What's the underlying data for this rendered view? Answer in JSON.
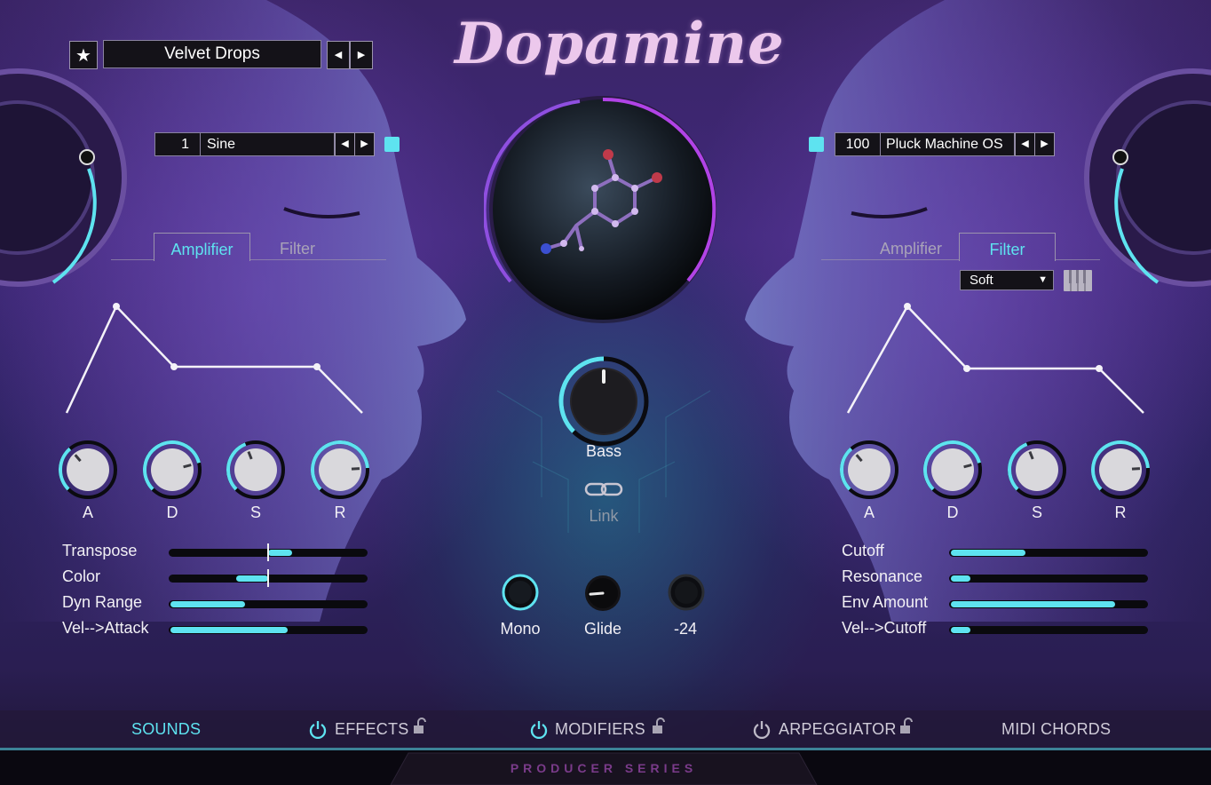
{
  "app": {
    "logo_text": "Dopamine",
    "footer_text": "PRODUCER SERIES"
  },
  "preset": {
    "name": "Velvet Drops",
    "favorite_icon": "star-icon",
    "prev_icon": "triangle-left-icon",
    "next_icon": "triangle-right-icon"
  },
  "left": {
    "osc_number": "1",
    "osc_name": "Sine",
    "tabs": [
      {
        "label": "Amplifier",
        "active": true
      },
      {
        "label": "Filter",
        "active": false
      }
    ],
    "knobs": [
      {
        "label": "A",
        "value": 0.35
      },
      {
        "label": "D",
        "value": 0.78
      },
      {
        "label": "S",
        "value": 0.42
      },
      {
        "label": "R",
        "value": 0.82
      }
    ],
    "params": [
      {
        "label": "Transpose",
        "value": 0.62,
        "bipolar": true
      },
      {
        "label": "Color",
        "value": 0.34,
        "bipolar": true
      },
      {
        "label": "Dyn Range",
        "value": 0.38,
        "bipolar": false
      },
      {
        "label": "Vel-->Attack",
        "value": 0.6,
        "bipolar": false
      }
    ]
  },
  "right": {
    "osc_number": "100",
    "osc_name": "Pluck Machine OS",
    "tabs": [
      {
        "label": "Amplifier",
        "active": false
      },
      {
        "label": "Filter",
        "active": true
      }
    ],
    "filter_type": "Soft",
    "keyboard_icon": "piano-keys-icon",
    "knobs": [
      {
        "label": "A",
        "value": 0.35
      },
      {
        "label": "D",
        "value": 0.78
      },
      {
        "label": "S",
        "value": 0.42
      },
      {
        "label": "R",
        "value": 0.82
      }
    ],
    "params": [
      {
        "label": "Cutoff",
        "value": 0.38
      },
      {
        "label": "Resonance",
        "value": 0.1
      },
      {
        "label": "Env Amount",
        "value": 0.84
      },
      {
        "label": "Vel-->Cutoff",
        "value": 0.1
      }
    ]
  },
  "center": {
    "bass_label": "Bass",
    "bass_value": 0.5,
    "link_label": "Link",
    "link_icon": "chain-link-icon",
    "mono_label": "Mono",
    "glide_label": "Glide",
    "glide_value": 0.15,
    "pitch_label": "-24",
    "orb_icon": "molecule-icon"
  },
  "nav": {
    "sounds": "SOUNDS",
    "effects": "EFFECTS",
    "modifiers": "MODIFIERS",
    "arpeggiator": "ARPEGGIATOR",
    "midi_chords": "MIDI CHORDS",
    "power_icon": "power-icon",
    "lock_icon": "lock-icon"
  },
  "colors": {
    "accent": "#5ee3f0",
    "purple_ring": "#9a3fd8",
    "text": "#f2f0f5",
    "inactive_text": "#a9a3b8"
  }
}
